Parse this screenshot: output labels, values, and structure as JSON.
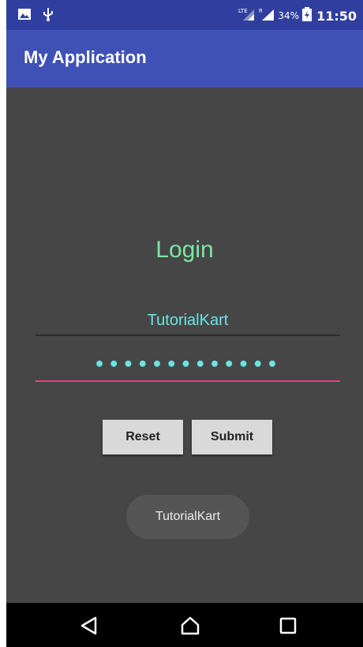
{
  "status_bar": {
    "network": "LTE",
    "roaming": "R",
    "battery_percent": "34%",
    "time": "11:50",
    "icons": [
      "image-icon",
      "usb-icon",
      "lte-signal-icon",
      "roaming-signal-icon",
      "battery-icon"
    ]
  },
  "app_bar": {
    "title": "My Application"
  },
  "login": {
    "heading": "Login",
    "username_value": "TutorialKart",
    "password_value": "•••••••••••••",
    "reset_label": "Reset",
    "submit_label": "Submit"
  },
  "toast": {
    "message": "TutorialKart"
  },
  "colors": {
    "status_bar": "#303f9f",
    "app_bar": "#3f51b5",
    "background": "#464646",
    "heading": "#7de6a5",
    "input_text": "#6ee3e3",
    "focused_underline": "#e0457f"
  },
  "nav_bar": {
    "icons": [
      "back-icon",
      "home-icon",
      "recents-icon"
    ]
  }
}
